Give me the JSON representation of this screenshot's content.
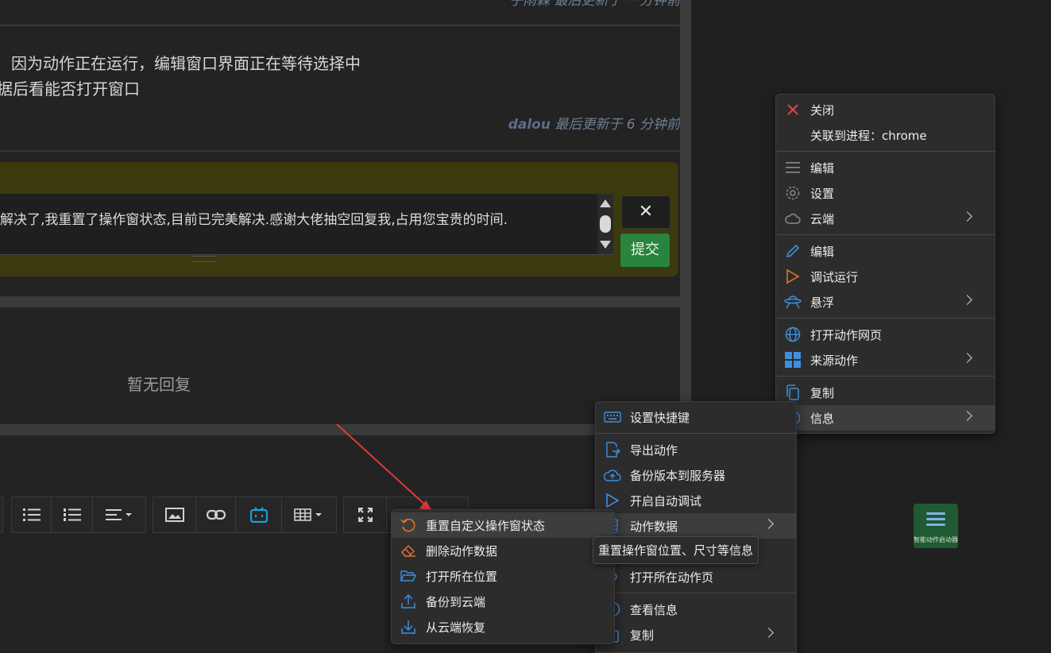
{
  "post": {
    "top_meta": "子雨霖 最后更新于 一分钟前",
    "line1": "因为动作正在运行，编辑窗口界面正在等待选择中",
    "line2": "据后看能否打开窗口",
    "author": "dalou",
    "updated": " 最后更新于 6 分钟前"
  },
  "reply": {
    "text": "解决了,我重置了操作窗状态,目前已完美解决.感谢大佬抽空回复我,占用您宝贵的时间.",
    "cancel_glyph": "✕",
    "submit_label": "提交"
  },
  "replies": {
    "empty_label": "暂无回复"
  },
  "context_menu_1": {
    "items": [
      {
        "label": "关闭",
        "icon": "close-icon",
        "color": "#e04848"
      },
      {
        "label": "关联到进程：chrome",
        "icon": "none"
      },
      {
        "label": "编辑",
        "icon": "list-icon"
      },
      {
        "label": "设置",
        "icon": "gear-icon"
      },
      {
        "label": "云端",
        "icon": "cloud-icon",
        "submenu": true
      },
      {
        "label": "编辑",
        "icon": "pencil-icon",
        "color": "#3d8fe0"
      },
      {
        "label": "调试运行",
        "icon": "play-outline-icon",
        "color": "#e0732f"
      },
      {
        "label": "悬浮",
        "icon": "ufo-icon",
        "color": "#3d8fe0",
        "submenu": true
      },
      {
        "label": "打开动作网页",
        "icon": "globe-icon",
        "color": "#3d8fe0"
      },
      {
        "label": "来源动作",
        "icon": "windows-icon",
        "color": "#3d8fe0",
        "submenu": true
      },
      {
        "label": "复制",
        "icon": "copy-icon",
        "color": "#3d8fe0"
      },
      {
        "label": "信息",
        "icon": "info-icon",
        "color": "#3d8fe0",
        "submenu": true,
        "highlighted": true
      }
    ]
  },
  "context_menu_2": {
    "items": [
      {
        "label": "设置快捷键",
        "icon": "keyboard-icon"
      },
      {
        "label": "导出动作",
        "icon": "export-icon"
      },
      {
        "label": "备份版本到服务器",
        "icon": "cloud-upload-icon"
      },
      {
        "label": "开启自动调试",
        "icon": "play-icon"
      },
      {
        "label": "动作数据",
        "icon": "database-icon",
        "submenu": true,
        "highlighted": true
      },
      {
        "label": "打开所在动作页",
        "icon": "link-icon"
      },
      {
        "label": "查看信息",
        "icon": "info-icon"
      },
      {
        "label": "复制",
        "icon": "copy-icon",
        "submenu": true
      }
    ]
  },
  "context_menu_3": {
    "items": [
      {
        "label": "重置自定义操作窗状态",
        "icon": "reset-icon",
        "color": "#e0732f",
        "highlighted": true
      },
      {
        "label": "删除动作数据",
        "icon": "eraser-icon",
        "color": "#e0732f"
      },
      {
        "label": "打开所在位置",
        "icon": "folder-open-icon",
        "color": "#3d8fe0"
      },
      {
        "label": "备份到云端",
        "icon": "upload-icon",
        "color": "#3d8fe0"
      },
      {
        "label": "从云端恢复",
        "icon": "download-icon",
        "color": "#3d8fe0"
      }
    ]
  },
  "tooltip": "重置操作窗位置、尺寸等信息",
  "fab": {
    "caption": "智能动作启动器"
  }
}
